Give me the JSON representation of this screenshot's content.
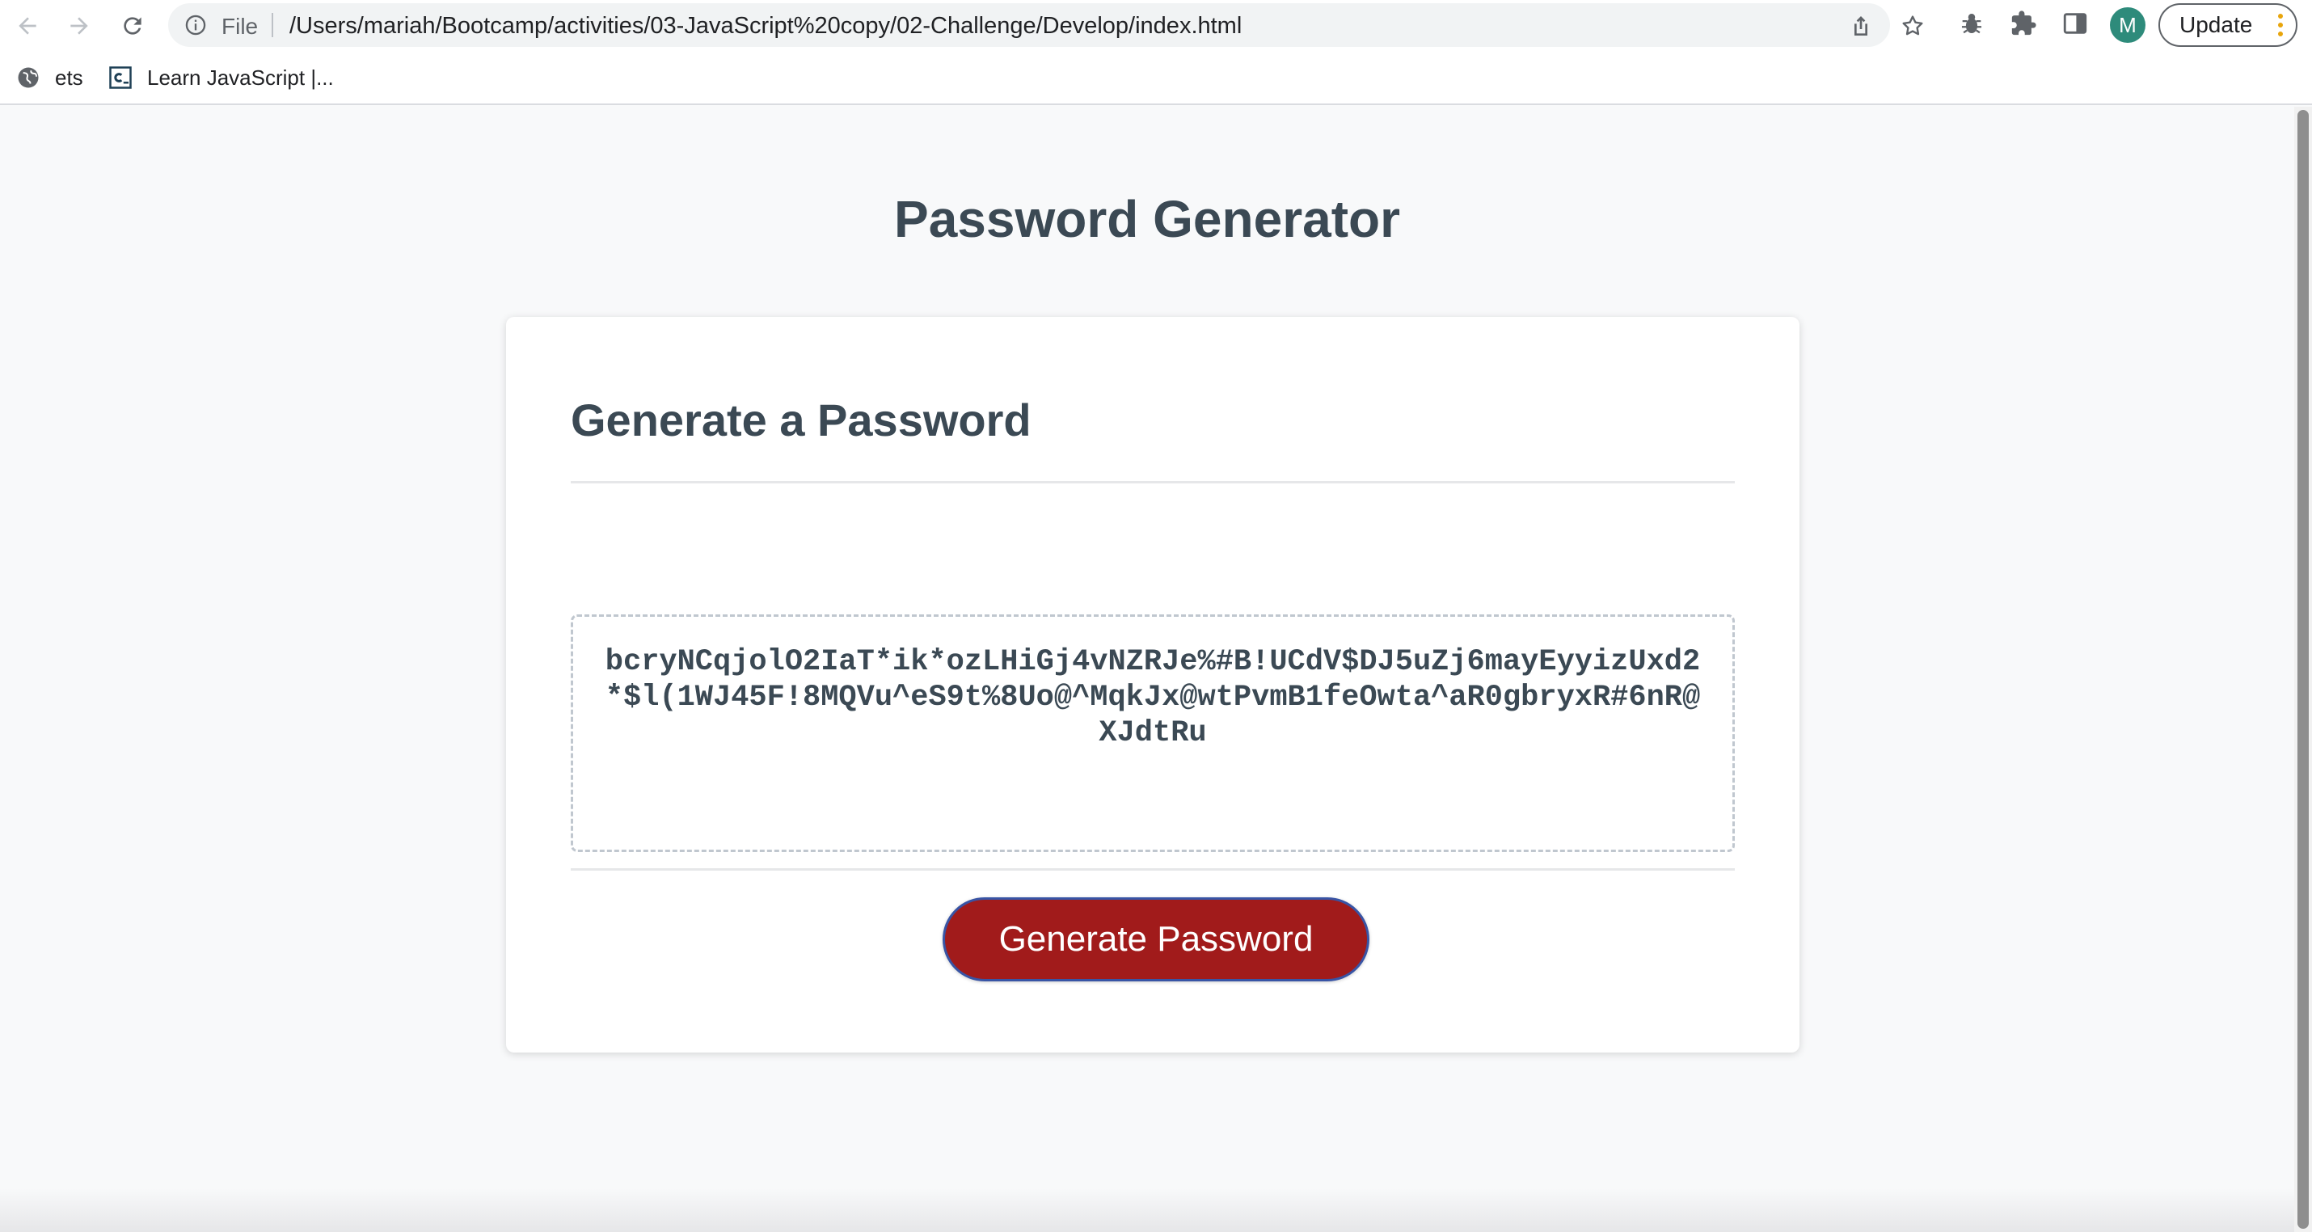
{
  "browser": {
    "omnibox": {
      "scheme_label": "File",
      "url": "/Users/mariah/Bootcamp/activities/03-JavaScript%20copy/02-Challenge/Develop/index.html"
    },
    "profile_initial": "M",
    "update_label": "Update",
    "bookmarks": [
      {
        "label": "ets",
        "icon": "globe-icon"
      },
      {
        "label": "Learn JavaScript |...",
        "icon": "codecademy-icon"
      }
    ],
    "icons": {
      "back": "arrow-left-icon",
      "forward": "arrow-right-icon",
      "reload": "reload-icon",
      "info": "info-icon",
      "share": "share-icon",
      "bookmark_star": "star-icon",
      "extension_bug": "bug-icon",
      "extensions": "puzzle-icon",
      "side_panel": "side-panel-icon",
      "menu": "kebab-menu-icon"
    },
    "colors": {
      "update_dots": "#e8a50c",
      "avatar_bg": "#2e8b7b"
    }
  },
  "page": {
    "title": "Password Generator",
    "card": {
      "header": "Generate a Password",
      "password_value": "bcryNCqjolO2IaT*ik*ozLHiGj4vNZRJe%#B!UCdV$DJ5uZj6mayEyyizUxd2*$l(1WJ45F!8MQVu^eS9t%8Uo@^MqkJx@wtPvmB1feOwta^aR0gbryxR#6nR@XJdtRu",
      "button_label": "Generate Password"
    },
    "colors": {
      "text": "#3c4a55",
      "button_bg": "#a11f1b",
      "button_border": "#3854a5"
    }
  }
}
